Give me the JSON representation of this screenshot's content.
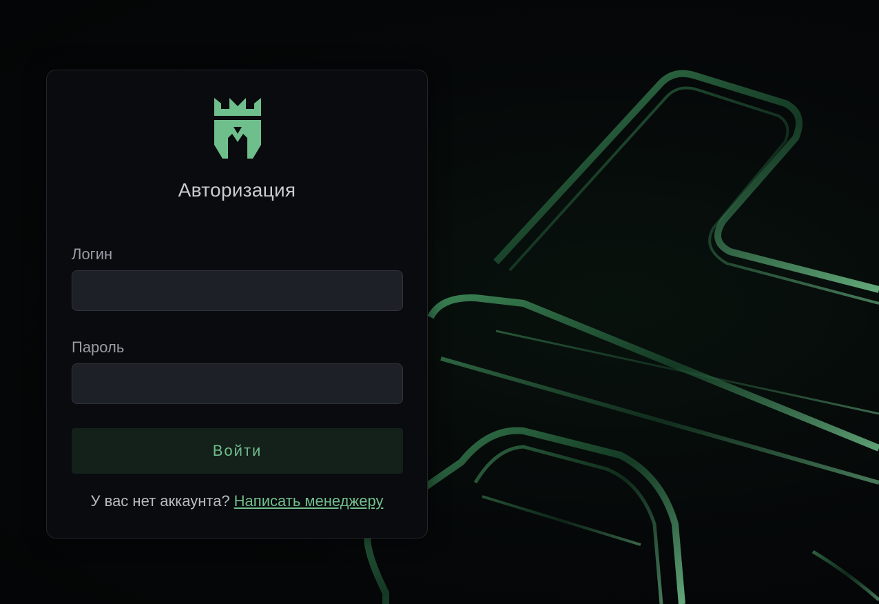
{
  "logo": {
    "icon": "crown-m-logo-icon",
    "color": "#6fbf8c"
  },
  "auth": {
    "title": "Авторизация",
    "login_label": "Логин",
    "login_value": "",
    "password_label": "Пароль",
    "password_value": "",
    "submit_label": "Войти",
    "no_account_text": "У вас нет аккаунта?",
    "manager_link": "Написать менеджеру"
  },
  "colors": {
    "accent": "#6fbf8c",
    "background": "#050708",
    "card": "#0a0b0e",
    "input": "#1e2028",
    "button": "#14201a"
  }
}
